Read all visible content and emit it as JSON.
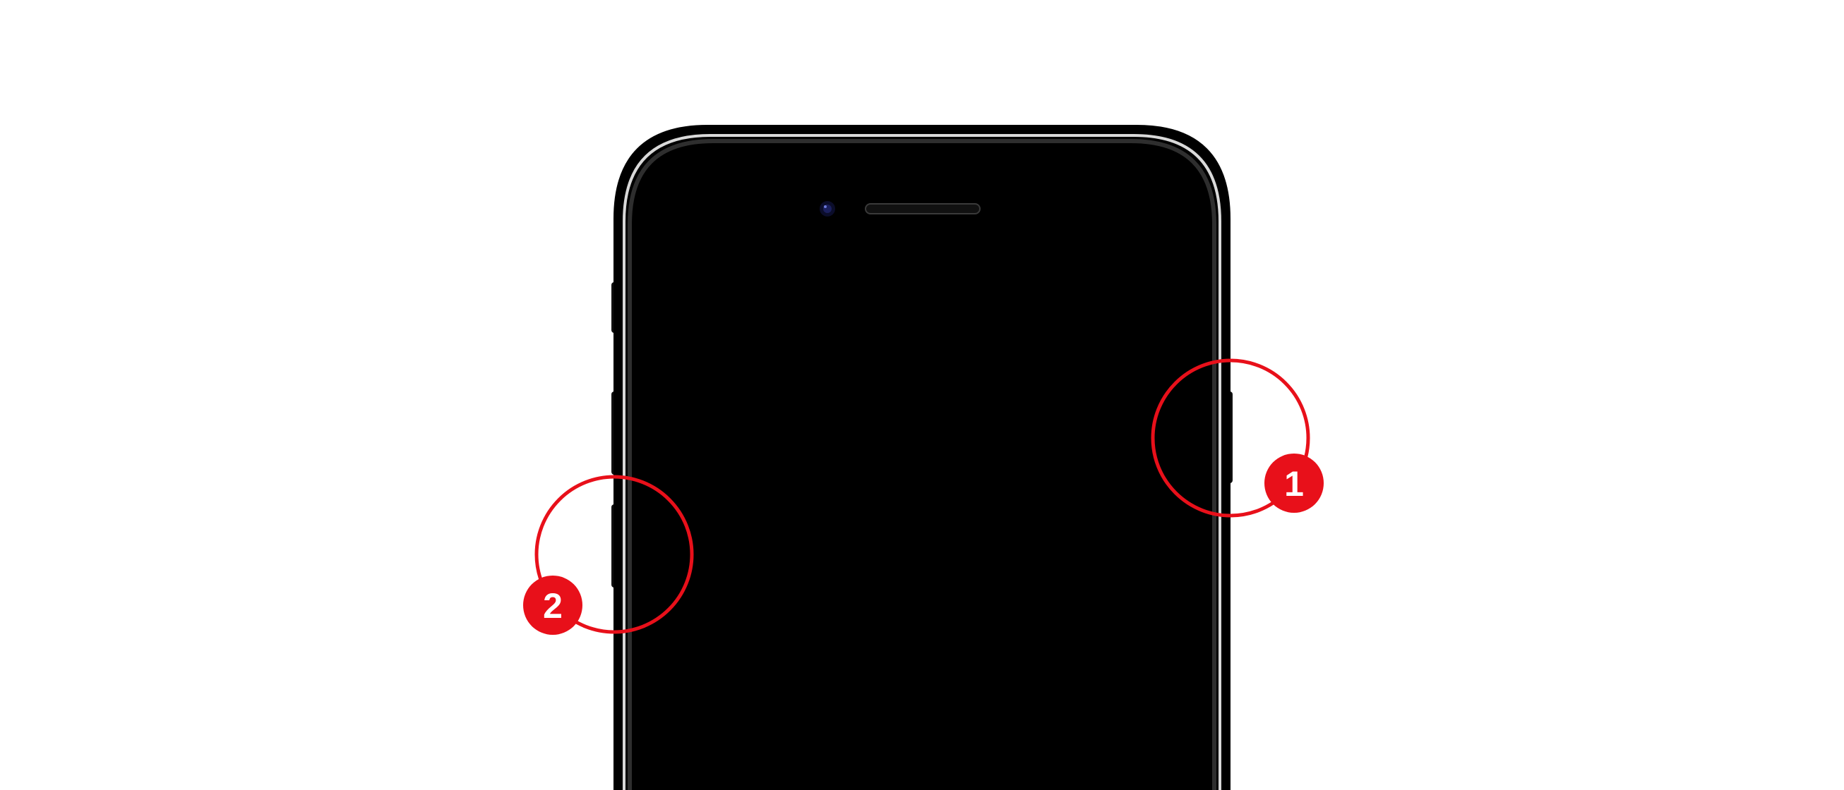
{
  "colors": {
    "background": "#ffffff",
    "phone_body": "#000000",
    "phone_bezel_highlight": "#3a3a3a",
    "annotation_red": "#e8101a",
    "badge_text": "#ffffff",
    "camera_lens": "#1a1f5c"
  },
  "device": {
    "name_icon": "smartphone-front-icon",
    "camera_icon": "front-camera-icon",
    "speaker_icon": "earpiece-speaker-icon"
  },
  "annotations": [
    {
      "label": "1",
      "target": "side-button",
      "icon": "highlight-circle-icon"
    },
    {
      "label": "2",
      "target": "volume-down-button",
      "icon": "highlight-circle-icon"
    }
  ]
}
